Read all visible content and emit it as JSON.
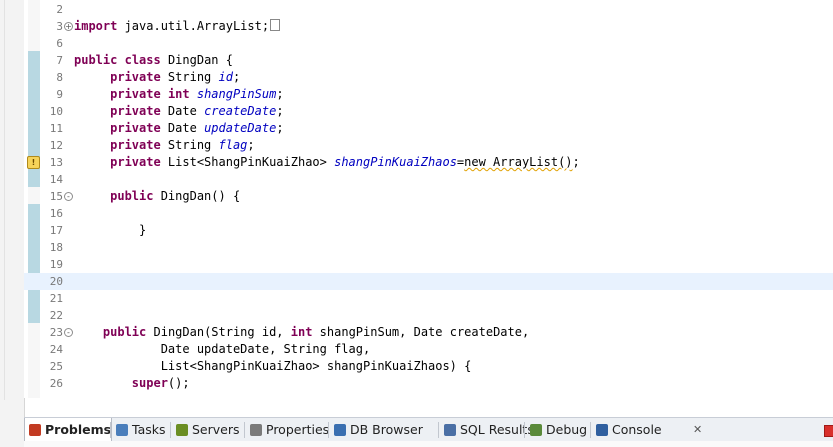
{
  "editor": {
    "lines": [
      {
        "n": "2",
        "fold": "",
        "segs": []
      },
      {
        "n": "3",
        "fold": "+",
        "segs": [
          {
            "t": "import",
            "c": "kw"
          },
          {
            "t": " java.util.ArrayList;"
          },
          {
            "t": "",
            "c": "box"
          }
        ]
      },
      {
        "n": "6",
        "fold": "",
        "segs": []
      },
      {
        "n": "7",
        "fold": "",
        "segs": [
          {
            "t": "public",
            "c": "kw"
          },
          {
            "t": " "
          },
          {
            "t": "class",
            "c": "kw"
          },
          {
            "t": " DingDan {"
          }
        ]
      },
      {
        "n": "8",
        "fold": "",
        "segs": [
          {
            "t": "     "
          },
          {
            "t": "private",
            "c": "kw"
          },
          {
            "t": " String "
          },
          {
            "t": "id",
            "c": "fld"
          },
          {
            "t": ";"
          }
        ]
      },
      {
        "n": "9",
        "fold": "",
        "segs": [
          {
            "t": "     "
          },
          {
            "t": "private",
            "c": "kw"
          },
          {
            "t": " "
          },
          {
            "t": "int",
            "c": "kw"
          },
          {
            "t": " "
          },
          {
            "t": "shangPinSum",
            "c": "fld"
          },
          {
            "t": ";"
          }
        ]
      },
      {
        "n": "10",
        "fold": "",
        "segs": [
          {
            "t": "     "
          },
          {
            "t": "private",
            "c": "kw"
          },
          {
            "t": " Date "
          },
          {
            "t": "createDate",
            "c": "fld"
          },
          {
            "t": ";"
          }
        ]
      },
      {
        "n": "11",
        "fold": "",
        "segs": [
          {
            "t": "     "
          },
          {
            "t": "private",
            "c": "kw"
          },
          {
            "t": " Date "
          },
          {
            "t": "updateDate",
            "c": "fld"
          },
          {
            "t": ";"
          }
        ]
      },
      {
        "n": "12",
        "fold": "",
        "segs": [
          {
            "t": "     "
          },
          {
            "t": "private",
            "c": "kw"
          },
          {
            "t": " String "
          },
          {
            "t": "flag",
            "c": "fld"
          },
          {
            "t": ";"
          }
        ]
      },
      {
        "n": "13",
        "fold": "",
        "warn": true,
        "segs": [
          {
            "t": "     "
          },
          {
            "t": "private",
            "c": "kw"
          },
          {
            "t": " List<ShangPinKuaiZhao> "
          },
          {
            "t": "shangPinKuaiZhaos",
            "c": "fld"
          },
          {
            "t": "="
          },
          {
            "t": "new ArrayList()",
            "c": "warn"
          },
          {
            "t": ";"
          }
        ]
      },
      {
        "n": "14",
        "fold": "",
        "segs": []
      },
      {
        "n": "15",
        "fold": "-",
        "segs": [
          {
            "t": "     "
          },
          {
            "t": "public",
            "c": "kw"
          },
          {
            "t": " DingDan() {"
          }
        ]
      },
      {
        "n": "16",
        "fold": "",
        "segs": []
      },
      {
        "n": "17",
        "fold": "",
        "segs": [
          {
            "t": "         }"
          }
        ]
      },
      {
        "n": "18",
        "fold": "",
        "segs": []
      },
      {
        "n": "19",
        "fold": "",
        "segs": []
      },
      {
        "n": "20",
        "fold": "",
        "current": true,
        "segs": []
      },
      {
        "n": "21",
        "fold": "",
        "segs": []
      },
      {
        "n": "22",
        "fold": "",
        "segs": []
      },
      {
        "n": "23",
        "fold": "-",
        "segs": [
          {
            "t": "    "
          },
          {
            "t": "public",
            "c": "kw"
          },
          {
            "t": " DingDan(String id, "
          },
          {
            "t": "int",
            "c": "kw"
          },
          {
            "t": " shangPinSum, Date createDate,"
          }
        ]
      },
      {
        "n": "24",
        "fold": "",
        "segs": [
          {
            "t": "            Date updateDate, String flag,"
          }
        ]
      },
      {
        "n": "25",
        "fold": "",
        "segs": [
          {
            "t": "            List<ShangPinKuaiZhao> shangPinKuaiZhaos) {"
          }
        ]
      },
      {
        "n": "26",
        "fold": "",
        "segs": [
          {
            "t": "        "
          },
          {
            "t": "super",
            "c": "kw"
          },
          {
            "t": "();"
          }
        ]
      }
    ]
  },
  "bottom_tabs": [
    {
      "label": "Problems",
      "icon": "problems-icon",
      "color": "#c23b22",
      "active": true
    },
    {
      "label": "Tasks",
      "icon": "tasks-icon",
      "color": "#4a7ebb",
      "active": false
    },
    {
      "label": "Servers",
      "icon": "servers-icon",
      "color": "#6b8e23",
      "active": false
    },
    {
      "label": "Properties",
      "icon": "properties-icon",
      "color": "#7a7a7a",
      "active": false
    },
    {
      "label": "DB Browser",
      "icon": "db-browser-icon",
      "color": "#3a6fb0",
      "active": false
    },
    {
      "label": "SQL Results",
      "icon": "sql-results-icon",
      "color": "#4a6fa5",
      "active": false
    },
    {
      "label": "Debug",
      "icon": "debug-icon",
      "color": "#5a8a3a",
      "active": false
    },
    {
      "label": "Console",
      "icon": "console-icon",
      "color": "#2f5f9f",
      "active": false
    }
  ],
  "console_close": "✕"
}
